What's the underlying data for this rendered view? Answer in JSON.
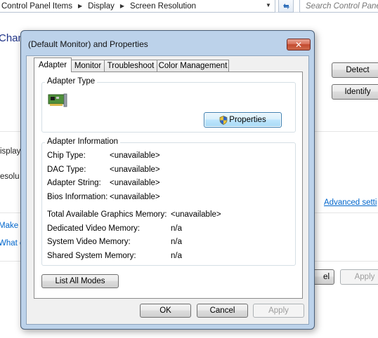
{
  "explorer": {
    "breadcrumbs": [
      "Control Panel Items",
      "Display",
      "Screen Resolution"
    ],
    "search_placeholder": "Search Control Panel",
    "heading_fragment": "Chan",
    "side_text_1": "isplay",
    "side_text_2": "esolu",
    "link_make": "Make t",
    "link_what": "What c",
    "detect_label": "Detect",
    "identify_label": "Identify",
    "advanced_link": "Advanced setti",
    "cancel_fragment": "el",
    "apply_label": "Apply"
  },
  "dialog": {
    "title": "(Default Monitor) and  Properties",
    "close_glyph": "✕",
    "tabs": [
      {
        "label": "Adapter",
        "active": true
      },
      {
        "label": "Monitor",
        "active": false
      },
      {
        "label": "Troubleshoot",
        "active": false
      },
      {
        "label": "Color Management",
        "active": false
      }
    ],
    "adapter_type": {
      "group_label": "Adapter Type",
      "properties_label": "Properties"
    },
    "adapter_info": {
      "group_label": "Adapter Information",
      "rows": [
        {
          "label": "Chip Type:",
          "value": "<unavailable>"
        },
        {
          "label": "DAC Type:",
          "value": "<unavailable>"
        },
        {
          "label": "Adapter String:",
          "value": "<unavailable>"
        },
        {
          "label": "Bios Information:",
          "value": "<unavailable>"
        }
      ],
      "memory_rows": [
        {
          "label": "Total Available Graphics Memory:",
          "value": "<unavailable>"
        },
        {
          "label": "Dedicated Video Memory:",
          "value": "n/a"
        },
        {
          "label": "System Video Memory:",
          "value": "n/a"
        },
        {
          "label": "Shared System Memory:",
          "value": "n/a"
        }
      ]
    },
    "list_all_modes_label": "List All Modes",
    "ok_label": "OK",
    "cancel_label": "Cancel",
    "apply_label": "Apply"
  }
}
